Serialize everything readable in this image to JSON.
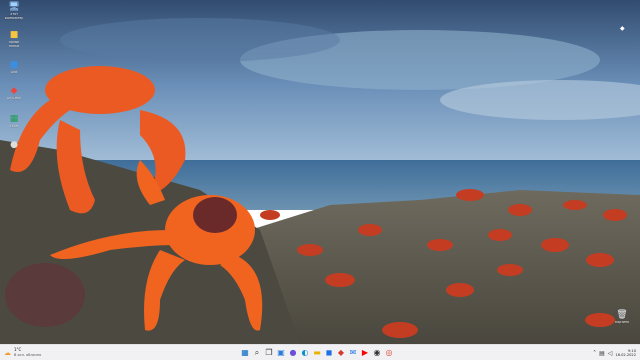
{
  "desktop": {
    "icons_left": [
      {
        "label": "Этот\nкомпьютер",
        "icon": "pc-icon"
      },
      {
        "label": "Ярлык\nпапки",
        "icon": "folder-icon"
      },
      {
        "label": "Alta",
        "icon": "app-icon"
      },
      {
        "label": "AnyDesk",
        "icon": "anydesk-icon"
      },
      {
        "label": "Excel",
        "icon": "excel-icon"
      },
      {
        "label": "",
        "icon": "app-icon"
      }
    ],
    "icons_right": [
      {
        "label": "Корзина",
        "icon": "recycle-bin-icon"
      }
    ]
  },
  "taskbar": {
    "weather": {
      "temp": "1°C",
      "desc": "В осн. облачно"
    },
    "apps": [
      {
        "name": "start-button",
        "glyph": "▦",
        "color": "#0067c0"
      },
      {
        "name": "search-button",
        "glyph": "⌕",
        "color": "#333333"
      },
      {
        "name": "task-view-button",
        "glyph": "❐",
        "color": "#333333"
      },
      {
        "name": "widgets-button",
        "glyph": "▣",
        "color": "#2a7ad6"
      },
      {
        "name": "chat-button",
        "glyph": "●",
        "color": "#6b4fd8"
      },
      {
        "name": "edge-button",
        "glyph": "◐",
        "color": "#0f8fc9"
      },
      {
        "name": "explorer-button",
        "glyph": "▬",
        "color": "#e8b400"
      },
      {
        "name": "store-button",
        "glyph": "◼",
        "color": "#1f6fe5"
      },
      {
        "name": "photos-button",
        "glyph": "◆",
        "color": "#d43a2f"
      },
      {
        "name": "mail-button",
        "glyph": "✉",
        "color": "#1a73e8"
      },
      {
        "name": "youtube-button",
        "glyph": "▶",
        "color": "#ff0000"
      },
      {
        "name": "app-button",
        "glyph": "◉",
        "color": "#333333"
      },
      {
        "name": "chrome-button",
        "glyph": "◎",
        "color": "#db4437"
      }
    ],
    "clock": {
      "time": "9:10",
      "date": "16.02.2022"
    }
  },
  "colors": {
    "taskbar_bg": "#f1f1f4",
    "accent": "#0067c0"
  }
}
